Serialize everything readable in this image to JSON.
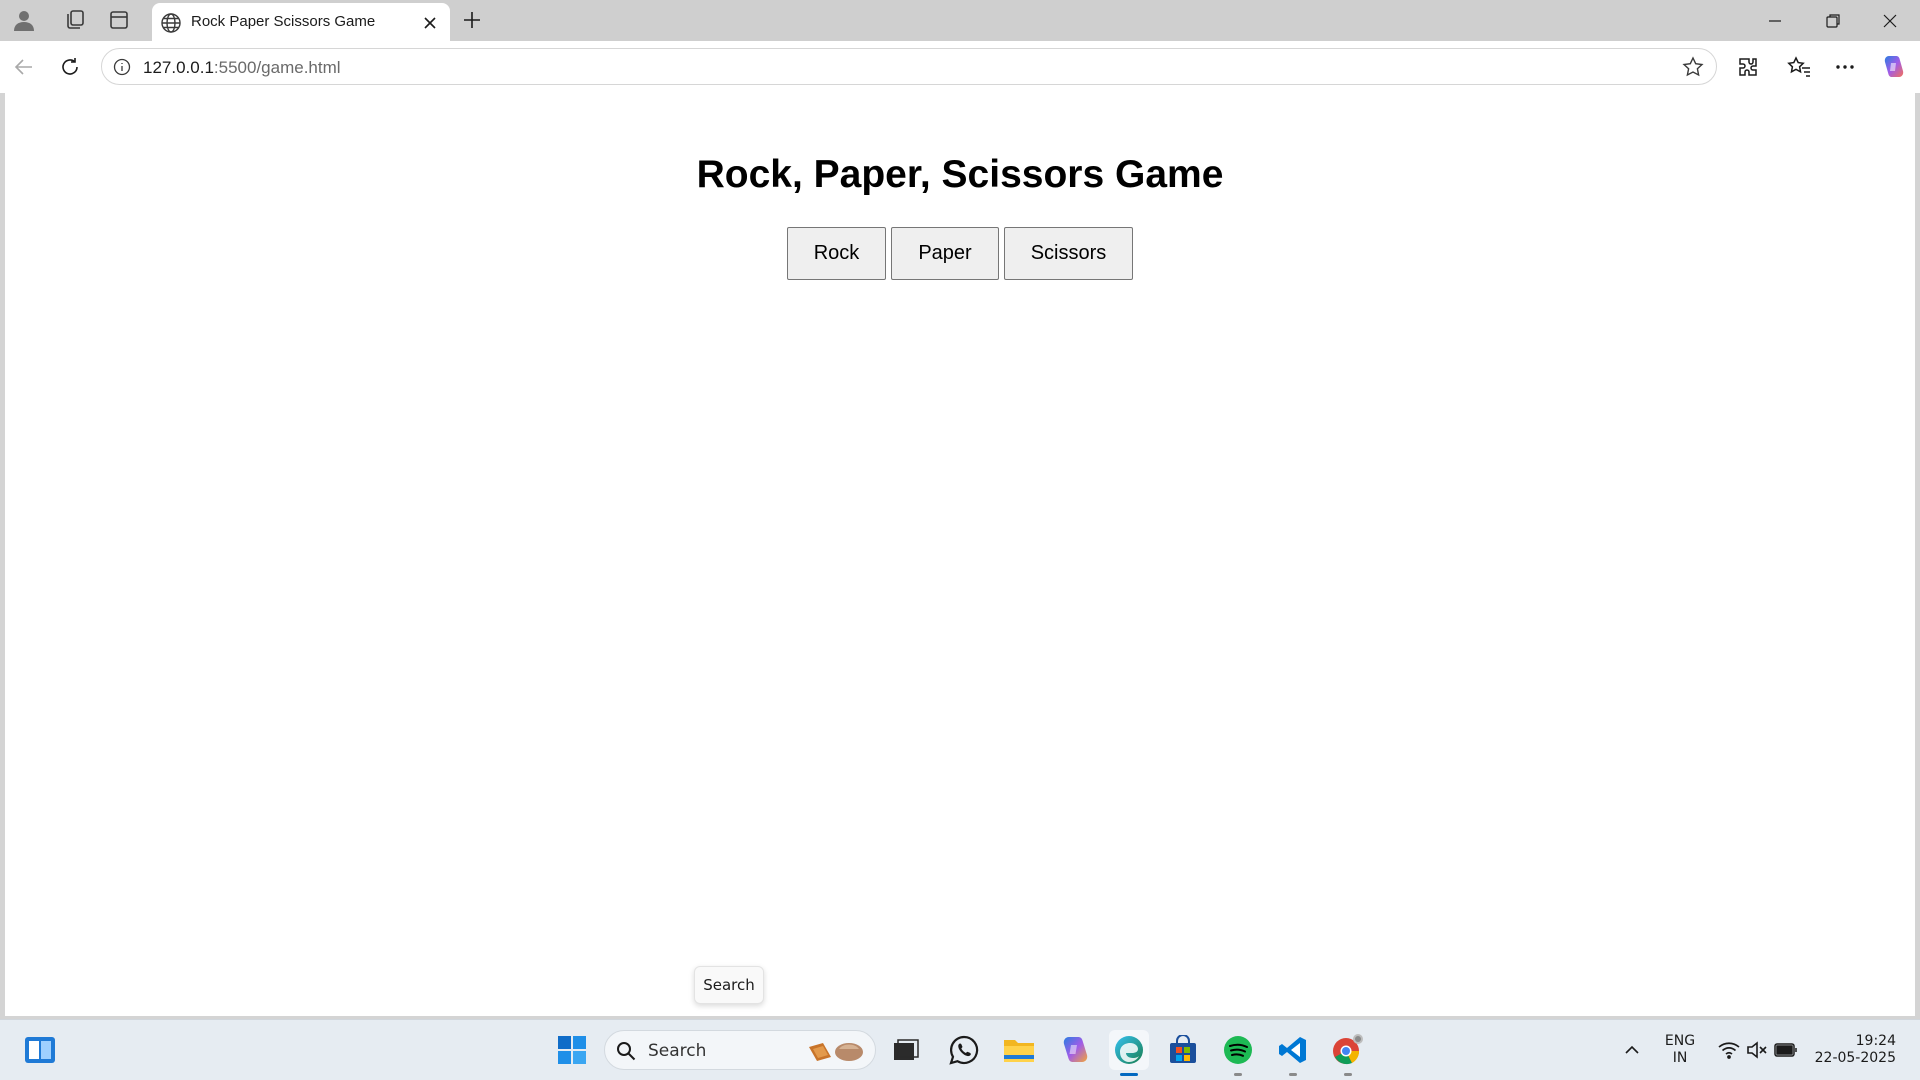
{
  "browser": {
    "tab": {
      "title": "Rock Paper Scissors Game"
    },
    "address": {
      "host": "127.0.0.1",
      "path": ":5500/game.html"
    }
  },
  "page": {
    "heading": "Rock, Paper, Scissors Game",
    "buttons": [
      "Rock",
      "Paper",
      "Scissors"
    ],
    "tooltip": "Search"
  },
  "taskbar": {
    "search_label": "Search",
    "language": {
      "line1": "ENG",
      "line2": "IN"
    },
    "clock": {
      "time": "19:24",
      "date": "22-05-2025"
    }
  },
  "colors": {
    "accent": "#0067c0",
    "spotify": "#1db954",
    "whatsapp": "#1b1b1b",
    "vscode": "#0078d4"
  }
}
